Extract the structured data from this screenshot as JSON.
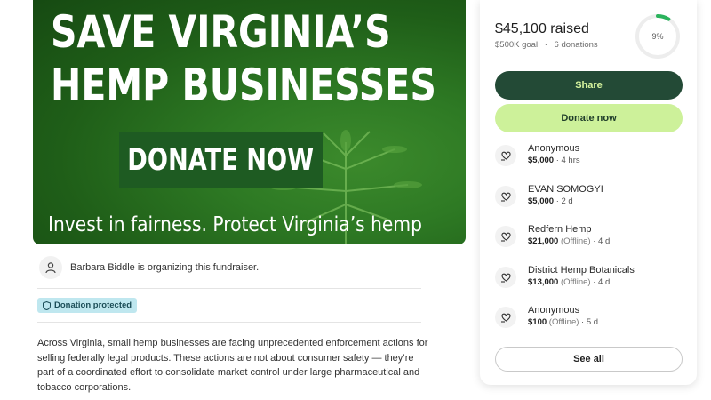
{
  "hero": {
    "title_line1": "SAVE VIRGINIA’S",
    "title_line2": "HEMP BUSINESSES",
    "cta": "DONATE NOW",
    "tagline": "Invest in fairness. Protect Virginia’s hemp"
  },
  "organizer": {
    "text": "Barbara Biddle is organizing this fundraiser.",
    "icon": "person-icon"
  },
  "badge": {
    "label": "Donation protected",
    "icon": "shield-icon"
  },
  "story": {
    "text": "Across Virginia, small hemp businesses are facing unprecedented enforcement actions for selling federally legal products. These actions are not about consumer safety — they’re part of a coordinated effort to consolidate market control under large pharmaceutical and tobacco corporations."
  },
  "summary": {
    "raised": "$45,100 raised",
    "goal": "$500K goal",
    "separator": "·",
    "donations": "6 donations",
    "percent_label": "9%",
    "progress": 0.09
  },
  "buttons": {
    "share": "Share",
    "donate": "Donate now",
    "see_all": "See all"
  },
  "donations": [
    {
      "name": "Anonymous",
      "amount": "$5,000",
      "offline": "",
      "time": " · 4 hrs"
    },
    {
      "name": "EVAN SOMOGYI",
      "amount": "$5,000",
      "offline": "",
      "time": " · 2 d"
    },
    {
      "name": "Redfern Hemp",
      "amount": "$21,000",
      "offline": " (Offline)",
      "time": " · 4 d"
    },
    {
      "name": "District Hemp Botanicals",
      "amount": "$13,000",
      "offline": " (Offline)",
      "time": " · 4 d"
    },
    {
      "name": "Anonymous",
      "amount": "$100",
      "offline": " (Offline)",
      "time": " · 5 d"
    }
  ],
  "colors": {
    "share_bg": "#234a36",
    "share_text": "#d7f59f",
    "donate_bg": "#cdf19a",
    "progress": "#2ab35c",
    "badge_bg": "#bfe7ef"
  }
}
